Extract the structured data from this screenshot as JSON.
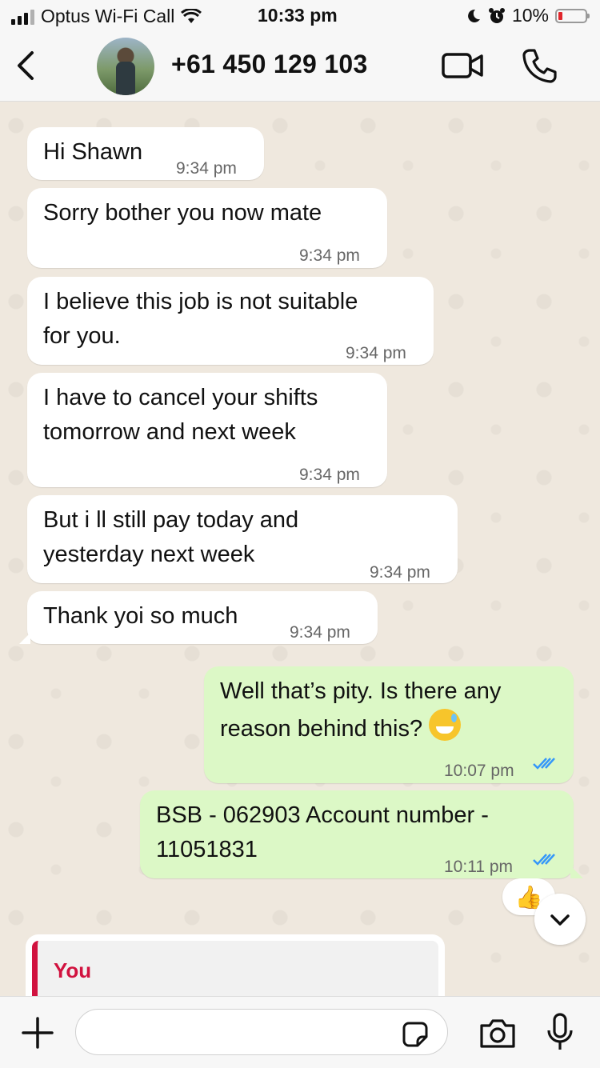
{
  "status_bar": {
    "carrier": "Optus Wi-Fi Call",
    "time": "10:33 pm",
    "battery": "10%",
    "icons": [
      "signal-icon",
      "wifi-icon",
      "moon-icon",
      "alarm-icon",
      "battery-icon"
    ]
  },
  "header": {
    "contact_name": "+61 450 129 103",
    "icons": [
      "back-chevron-icon",
      "avatar",
      "video-call-icon",
      "phone-icon"
    ]
  },
  "messages": [
    {
      "dir": "in",
      "text": "Hi Shawn",
      "time": "9:34 pm"
    },
    {
      "dir": "in",
      "text": "Sorry bother you now mate",
      "time": "9:34 pm"
    },
    {
      "dir": "in",
      "text": "I believe this job is not suitable\nfor you.",
      "time": "9:34 pm"
    },
    {
      "dir": "in",
      "text": "I have to cancel your shifts\ntomorrow and next week",
      "time": "9:34 pm"
    },
    {
      "dir": "in",
      "text": "But i ll still pay today and\nyesterday next week",
      "time": "9:34 pm"
    },
    {
      "dir": "in",
      "text": "Thank yoi so much",
      "time": "9:34 pm"
    },
    {
      "dir": "out",
      "text": "Well that’s pity. Is there any\nreason behind this?",
      "time": "10:07 pm",
      "emoji": "grinning-sweat-emoji",
      "status": "read"
    },
    {
      "dir": "out",
      "text": "BSB - 062903 Account number -\n11051831",
      "time": "10:11 pm",
      "status": "read"
    }
  ],
  "reaction": "👍",
  "reply_preview": {
    "sender": "You"
  },
  "input_bar": {
    "placeholder": ""
  },
  "colors": {
    "incoming": "#ffffff",
    "outgoing": "#dcf8c6",
    "read_ticks": "#3497f9",
    "reply_accent": "#d1123f",
    "chat_background": "#efe8de"
  }
}
